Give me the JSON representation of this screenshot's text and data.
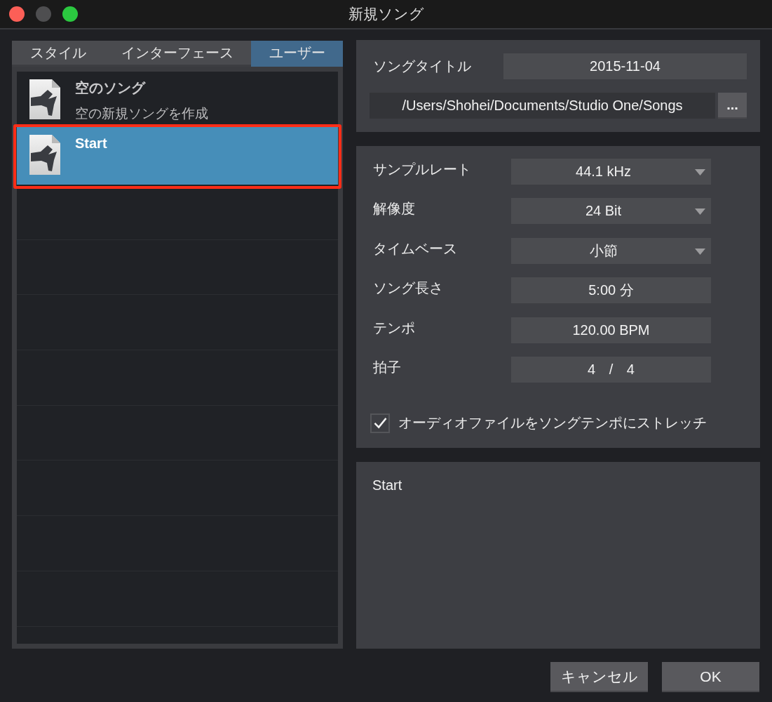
{
  "window": {
    "title": "新規ソング",
    "controls": [
      {
        "kind": "close",
        "disabled": false
      },
      {
        "kind": "minimize",
        "disabled": true
      },
      {
        "kind": "zoom",
        "disabled": false
      }
    ]
  },
  "tabs": [
    {
      "label": "スタイル",
      "selected": false
    },
    {
      "label": "インターフェース",
      "selected": false
    },
    {
      "label": "ユーザー",
      "selected": true
    }
  ],
  "templates": [
    {
      "title": "空のソング",
      "description": "空の新規ソングを作成",
      "selected": false,
      "highlighted": false
    },
    {
      "title": "Start",
      "selected": true,
      "highlighted": true
    }
  ],
  "song": {
    "title_label": "ソングタイトル",
    "title_value": "2015-11-04",
    "location": "/Users/Shohei/Documents/Studio One/Songs",
    "browse_button": "..."
  },
  "settings": [
    {
      "kind": "dropdown",
      "label": "サンプルレート",
      "value": "44.1 kHz"
    },
    {
      "kind": "dropdown",
      "label": "解像度",
      "value": "24 Bit"
    },
    {
      "kind": "dropdown",
      "label": "タイムベース",
      "value": "小節"
    },
    {
      "kind": "field",
      "label": "ソング長さ",
      "value": "5:00 分"
    },
    {
      "kind": "field",
      "label": "テンポ",
      "value": "120.00 BPM"
    },
    {
      "kind": "signature",
      "label": "拍子",
      "value": "4 / 4"
    }
  ],
  "stretch_option": {
    "label": "オーディオファイルをソングテンポにストレッチ",
    "checked": true
  },
  "description": {
    "text": "Start"
  },
  "buttons": [
    "キャンセル",
    "OK"
  ]
}
